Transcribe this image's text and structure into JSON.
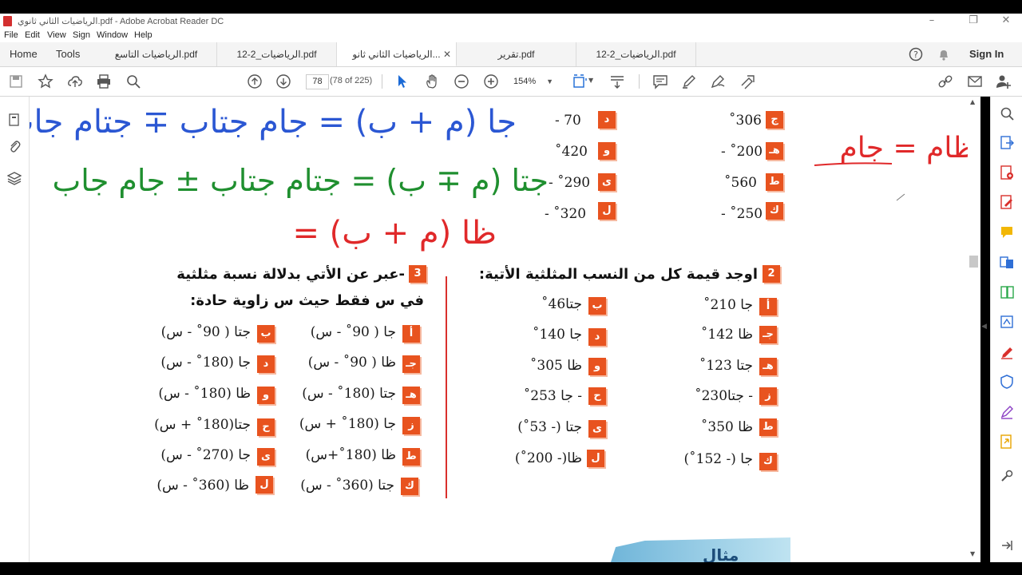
{
  "window": {
    "title": "الرياضيات الثاني ثانوي.pdf - Adobe Acrobat Reader DC"
  },
  "menu": [
    "File",
    "Edit",
    "View",
    "Sign",
    "Window",
    "Help"
  ],
  "nav": {
    "home": "Home",
    "tools": "Tools",
    "signin": "Sign In"
  },
  "tabs": [
    {
      "label": "الرياضيات التاسع.pdf",
      "active": false
    },
    {
      "label": "12-2_الرياضيات.pdf",
      "active": false
    },
    {
      "label": "الرياضيات الثاني ثانو...",
      "active": true
    },
    {
      "label": "تقرير.pdf",
      "active": false
    },
    {
      "label": "12-2_الرياضيات.pdf",
      "active": false
    }
  ],
  "toolbar": {
    "page_current": "78",
    "page_total": "(78 of 225)",
    "zoom": "154%"
  },
  "handwriting": {
    "line1": "جا (م + ب) = جام جتاب ∓ جتام جاب",
    "line2": "جتا (م ∓ ب) = جتام جتاب ± جام جاب",
    "line3": "ظا (م + ب) =",
    "side": "ظام = جام"
  },
  "top_items": [
    {
      "label": "د",
      "expr": "70 -"
    },
    {
      "label": "ج",
      "expr": "306˚"
    },
    {
      "label": "و",
      "expr": "420˚"
    },
    {
      "label": "هـ",
      "expr": "200˚ -"
    },
    {
      "label": "ى",
      "expr": "290˚ -"
    },
    {
      "label": "ط",
      "expr": "560˚"
    },
    {
      "label": "ل",
      "expr": "320˚ -"
    },
    {
      "label": "ك",
      "expr": "250˚ -"
    }
  ],
  "section2": {
    "num": "2",
    "heading": "اوجد قيمة كل من النسب المثلثية الأتية:",
    "items": [
      {
        "label": "أ",
        "expr": "جا 210˚"
      },
      {
        "label": "ب",
        "expr": "جتا46˚"
      },
      {
        "label": "جـ",
        "expr": "ظا 142˚"
      },
      {
        "label": "د",
        "expr": "جا 140˚"
      },
      {
        "label": "هـ",
        "expr": "جتا 123˚"
      },
      {
        "label": "و",
        "expr": "ظا 305˚"
      },
      {
        "label": "ز",
        "expr": "- جتا230˚"
      },
      {
        "label": "ح",
        "expr": "- جا 253˚"
      },
      {
        "label": "ط",
        "expr": "ظا 350˚"
      },
      {
        "label": "ى",
        "expr": "جتا (- 53˚)"
      },
      {
        "label": "ك",
        "expr": "جا (- 152˚)"
      },
      {
        "label": "ل",
        "expr": "ظا(- 200˚)"
      }
    ]
  },
  "section3": {
    "num": "3",
    "heading1": "-عبر عن الأتي بدلالة نسبة مثلثية",
    "heading2": "في س فقط حيث س زاوية حادة:",
    "items": [
      {
        "label": "أ",
        "expr": "جا ( 90˚ - س)"
      },
      {
        "label": "ب",
        "expr": "جتا ( 90˚ - س)"
      },
      {
        "label": "جـ",
        "expr": "ظا ( 90˚ - س)"
      },
      {
        "label": "د",
        "expr": "جا (180˚ - س)"
      },
      {
        "label": "هـ",
        "expr": "جتا (180˚ - س)"
      },
      {
        "label": "و",
        "expr": "ظا (180˚ - س)"
      },
      {
        "label": "ز",
        "expr": "جا (180˚ + س)"
      },
      {
        "label": "ح",
        "expr": "جتا(180˚ + س)"
      },
      {
        "label": "ط",
        "expr": "ظا (180˚+س)"
      },
      {
        "label": "ى",
        "expr": "جا (270˚ - س)"
      },
      {
        "label": "ك",
        "expr": "جتا (360˚ - س)"
      },
      {
        "label": "ل",
        "expr": "ظا (360˚ - س)"
      }
    ]
  },
  "footer_badge": "مثال"
}
